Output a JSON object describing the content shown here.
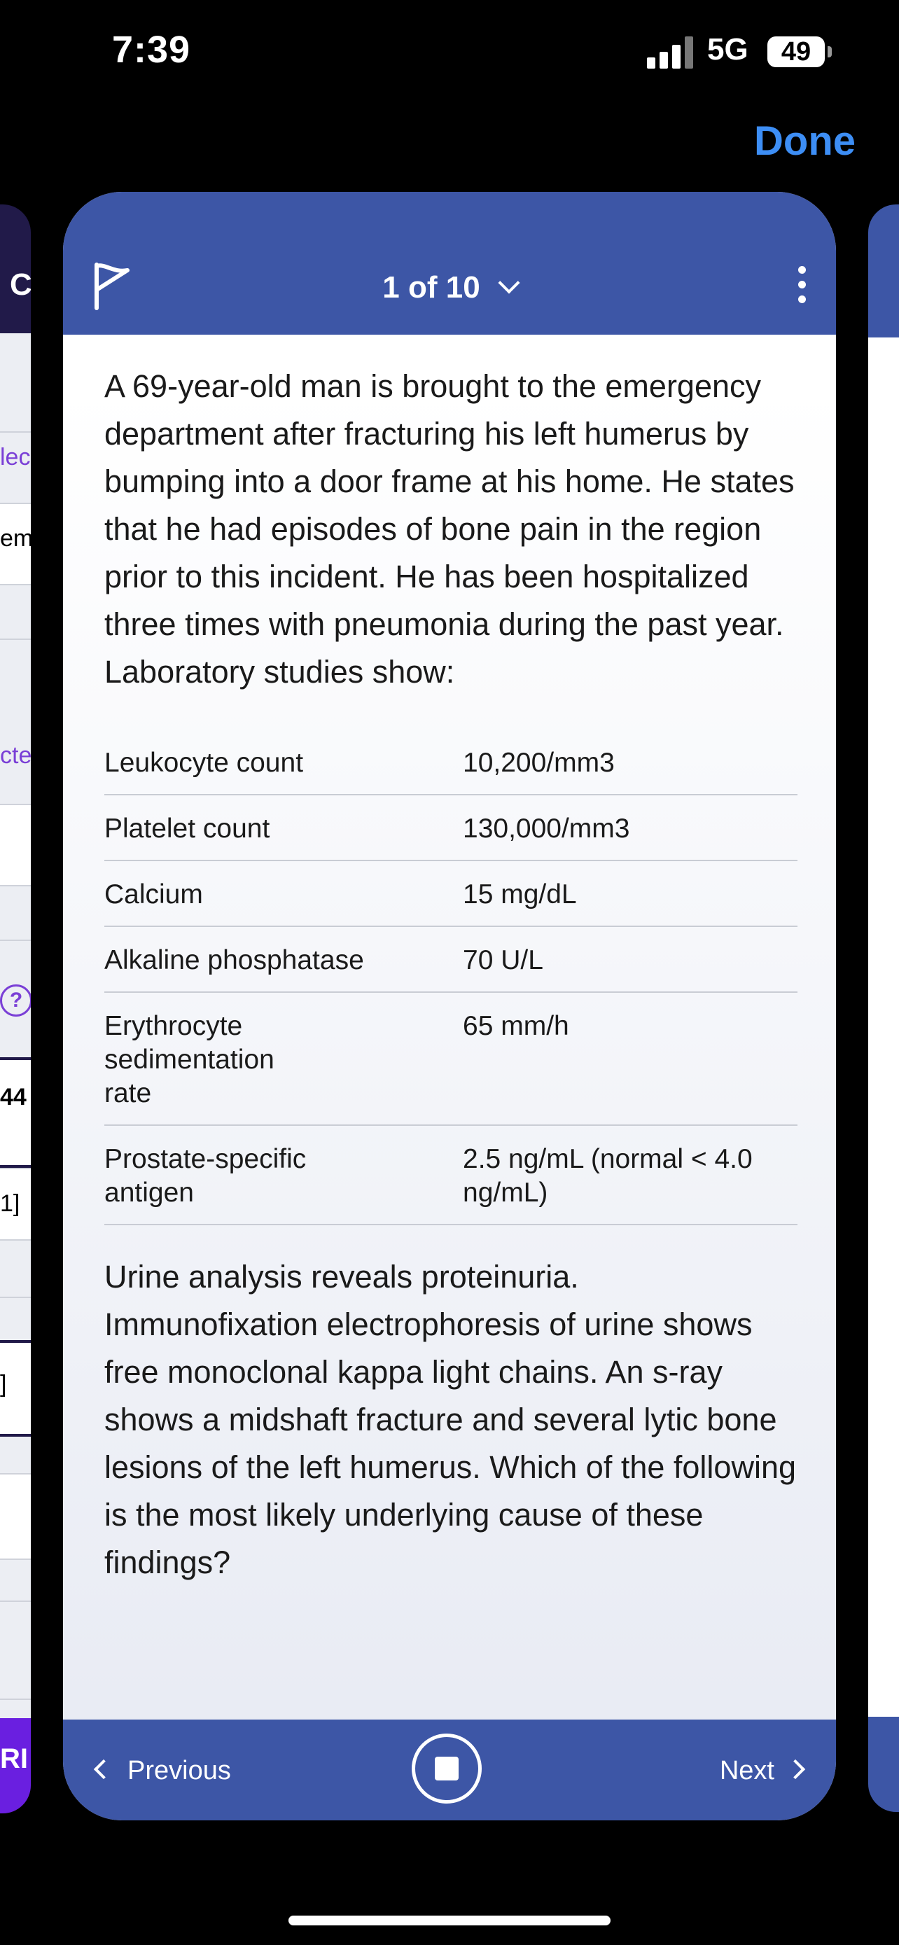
{
  "status_bar": {
    "time": "7:39",
    "network": "5G",
    "battery": "49"
  },
  "top": {
    "done_label": "Done"
  },
  "left_card": {
    "header_letter": "C",
    "fragments": [
      "lec",
      "em",
      "cte",
      "?",
      "44",
      "1]",
      "]",
      "RI"
    ]
  },
  "question": {
    "counter": "1 of 10",
    "stem_intro": "A 69-year-old man is brought to the emergency department after fracturing his left humerus by bumping into a door frame at his home. He states that he had episodes of bone pain in the region prior to this incident. He has been hospitalized three times with pneumonia during the past year. Laboratory studies show:",
    "labs": [
      {
        "name": "Leukocyte count",
        "value": "10,200/mm3"
      },
      {
        "name": "Platelet count",
        "value": "130,000/mm3"
      },
      {
        "name": "Calcium",
        "value": "15 mg/dL"
      },
      {
        "name": "Alkaline phosphatase",
        "value": "70 U/L"
      },
      {
        "name": "Erythrocyte sedimentation rate",
        "value": "65 mm/h"
      },
      {
        "name": "Prostate-specific antigen",
        "value": "2.5 ng/mL (normal < 4.0 ng/mL)"
      }
    ],
    "stem_outro": "Urine analysis reveals proteinuria. Immunofixation electrophoresis of urine shows free monoclonal kappa light chains. An s-ray shows a midshaft fracture and several lytic bone lesions of the left humerus. Which of the following is the most likely underlying cause of these findings?"
  },
  "footer": {
    "previous_label": "Previous",
    "next_label": "Next"
  },
  "icons": [
    "signal-icon",
    "battery-icon",
    "flag-icon",
    "chevron-down-icon",
    "more-vertical-icon",
    "chevron-left-icon",
    "stop-icon",
    "chevron-right-icon"
  ],
  "colors": {
    "header_blue": "#3d56a6",
    "done_blue": "#3d8ef5",
    "left_header": "#211a49",
    "left_footer": "#6a1fe0",
    "accent_purple": "#7a3fd6"
  }
}
